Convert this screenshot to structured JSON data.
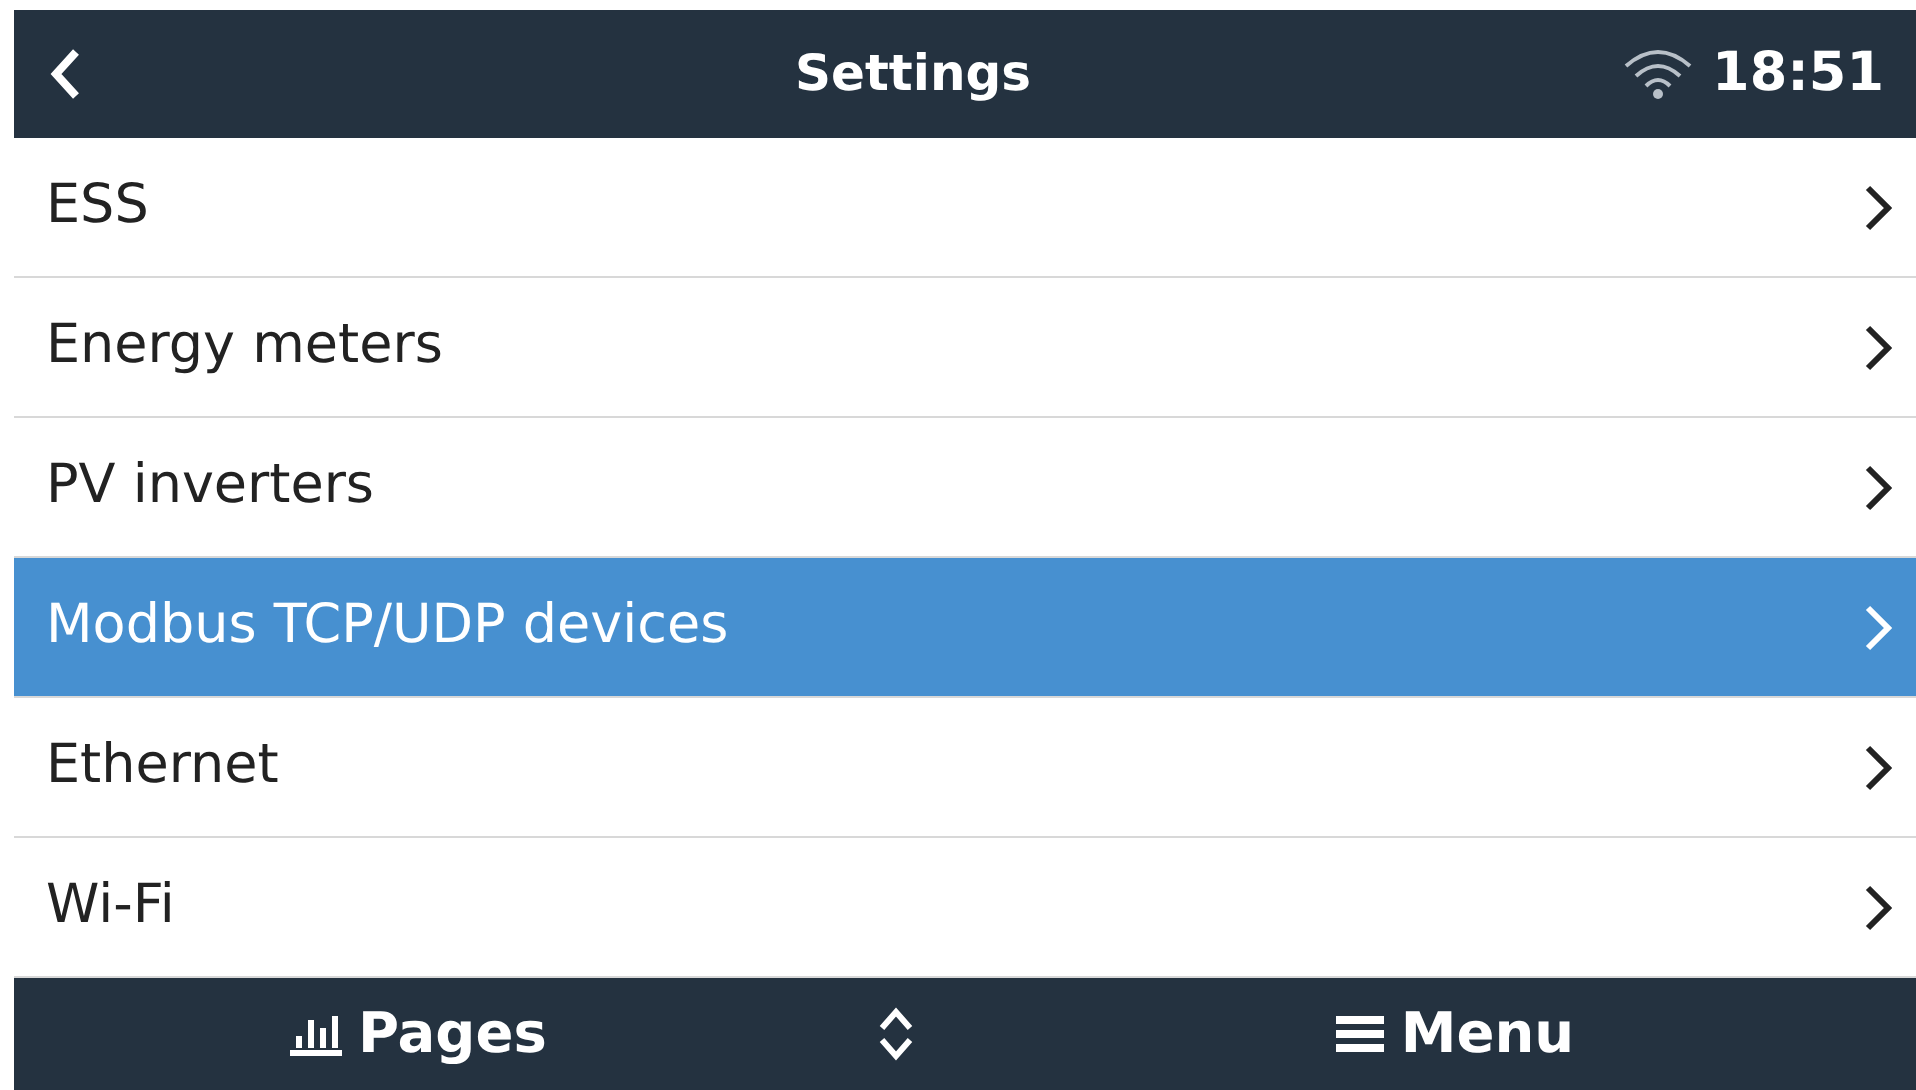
{
  "header": {
    "title": "Settings",
    "time": "18:51"
  },
  "items": [
    {
      "label": "ESS",
      "selected": false
    },
    {
      "label": "Energy meters",
      "selected": false
    },
    {
      "label": "PV inverters",
      "selected": false
    },
    {
      "label": "Modbus TCP/UDP devices",
      "selected": true
    },
    {
      "label": "Ethernet",
      "selected": false
    },
    {
      "label": "Wi-Fi",
      "selected": false
    }
  ],
  "footer": {
    "pages": "Pages",
    "menu": "Menu"
  }
}
